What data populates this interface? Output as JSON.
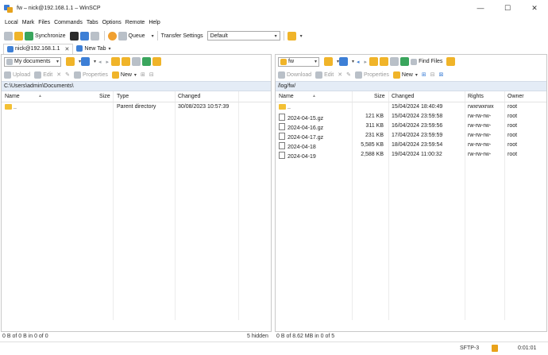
{
  "window": {
    "title": "fw – nick@192.168.1.1 – WinSCP",
    "controls": [
      "—",
      "☐",
      "✕"
    ]
  },
  "menu": [
    "Local",
    "Mark",
    "Files",
    "Commands",
    "Tabs",
    "Options",
    "Remote",
    "Help"
  ],
  "toolbar": {
    "synchronize": "Synchronize",
    "queue": "Queue",
    "transfer_settings": "Transfer Settings",
    "transfer_profile": "Default"
  },
  "tabs": {
    "session": "nick@192.168.1.1",
    "new_tab": "New Tab"
  },
  "local": {
    "location": "My documents",
    "actions": {
      "upload": "Upload",
      "edit": "Edit",
      "properties": "Properties",
      "new": "New"
    },
    "path": "C:\\Users\\admin\\Documents\\",
    "columns": [
      "Name",
      "Size",
      "Type",
      "Changed"
    ],
    "rows": [
      {
        "name": "..",
        "size": "",
        "type": "Parent directory",
        "changed": "30/08/2023 10:57:39"
      }
    ],
    "status": "0 B of 0 B in 0 of 0",
    "hidden": "5 hidden"
  },
  "remote": {
    "location": "fw",
    "actions": {
      "download": "Download",
      "edit": "Edit",
      "properties": "Properties",
      "new": "New",
      "find_files": "Find Files"
    },
    "path": "/log/fw/",
    "columns": [
      "Name",
      "Size",
      "Changed",
      "Rights",
      "Owner"
    ],
    "rows": [
      {
        "name": "..",
        "size": "",
        "changed": "15/04/2024 18:40:49",
        "rights": "rwxrwxrwx",
        "owner": "root"
      },
      {
        "name": "2024-04-15.gz",
        "size": "121 KB",
        "changed": "15/04/2024 23:59:58",
        "rights": "rw-rw-rw-",
        "owner": "root"
      },
      {
        "name": "2024-04-16.gz",
        "size": "311 KB",
        "changed": "16/04/2024 23:59:56",
        "rights": "rw-rw-rw-",
        "owner": "root"
      },
      {
        "name": "2024-04-17.gz",
        "size": "231 KB",
        "changed": "17/04/2024 23:59:59",
        "rights": "rw-rw-rw-",
        "owner": "root"
      },
      {
        "name": "2024-04-18",
        "size": "5,585 KB",
        "changed": "18/04/2024 23:59:54",
        "rights": "rw-rw-rw-",
        "owner": "root"
      },
      {
        "name": "2024-04-19",
        "size": "2,588 KB",
        "changed": "19/04/2024 11:00:32",
        "rights": "rw-rw-rw-",
        "owner": "root"
      }
    ],
    "status": "0 B of 8.62 MB in 0 of 5"
  },
  "statusbar": {
    "protocol": "SFTP-3",
    "elapsed": "0:01:01"
  }
}
